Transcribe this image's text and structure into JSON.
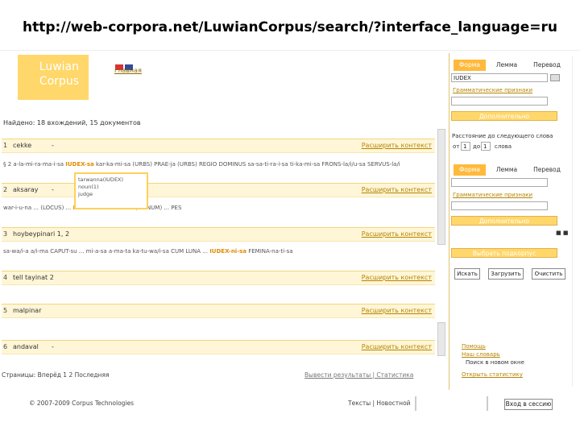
{
  "url": "http://web-corpora.net/LuwianCorpus/search/?interface_language=ru",
  "logo": {
    "line1": "Luwian",
    "line2": "Corpus"
  },
  "flags": {
    "c1": "#d73333",
    "c2": "#324a9a"
  },
  "main_link": "главная",
  "found_text": "Найдено: 18 вхождений, 15 документов",
  "results": [
    {
      "num": "1",
      "loc": "cekke",
      "context": "Расширить контекст",
      "text": "§ 2  a-la-mi-ra-ma-i-sa  IUDEX-sa  kar-ka-mi-sa  (URBS)  PRAE-ja  (URBS)  REGIO  DOMINUS  sa-sa-ti-ra-i-sa  ti-ka-mi-sa  FRONS-la/i/u-sa  SERVUS-la/i"
    },
    {
      "num": "2",
      "loc": "aksaray",
      "context": "Расширить контекст",
      "text": "war-i-u-na  ... (LOCUS)  ...  IUDEX-sa  ...  ARHA  ... (LIGNUM)  ...  PES"
    },
    {
      "num": "3",
      "loc": "hoybeypinari 1, 2",
      "context": "Расширить контекст",
      "text": "sa-wa/i-a  a/i-ma  CAPUT-su ... mi-a-sa  a-ma-ta  ka-tu-wa/i-sa  CUM  LUNA  ...  IUDEX-ni-sa  FEMINA-na-ti-sa"
    },
    {
      "num": "4",
      "loc": "tell tayinat 2",
      "context": "Расширить контекст",
      "text": ""
    },
    {
      "num": "5",
      "loc": "malpinar",
      "context": "Расширить контекст",
      "text": ""
    },
    {
      "num": "6",
      "loc": "andaval",
      "context": "Расширить контекст",
      "text": ""
    }
  ],
  "tooltip": {
    "line1": "tarwanna(IUDEX)",
    "line2": "noun(1)",
    "line3": "judge"
  },
  "footnav": "Страницы: Вперёд  1  2  Последняя",
  "footlinks": "Вывести результаты  |  Статистика",
  "copyright": "© 2007-2009 Corpus Technologies",
  "side": {
    "tabs1": [
      "Форма",
      "Лемма",
      "Перевод"
    ],
    "input1_value": "IUDEX",
    "link_morph": "Грамматические признаки",
    "btn_add": "Дополнительно",
    "distance_label": "Расстояние до следующего слова",
    "from_label": "от",
    "from_val": "1",
    "to_label": "до",
    "to_val": "1",
    "unit": "слова",
    "tabs2": [
      "Форма",
      "Лемма",
      "Перевод"
    ],
    "link_morph2": "Грамматические признаки",
    "btn_add2": "Дополнительно",
    "link_subcorpus": "Выбрать подкорпус",
    "btn_search": "Искать",
    "btn_clear_ctx": "Загрузить",
    "btn_clear": "Очистить",
    "links_bottom": [
      "Помощь",
      "Наш словарь",
      "Поиск в новом окне"
    ],
    "link_stats": "Открыть статистику"
  },
  "lang_text": "Тексты  |  Новостной",
  "exit_btn": "Вход в сессию"
}
